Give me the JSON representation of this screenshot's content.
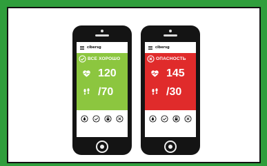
{
  "phones": [
    {
      "brand": "cibersg",
      "status_label": "ВСЕ ХОРОШО",
      "status_icon": "check-circle-icon",
      "status_color": "#8cc63f",
      "heart_rate": "120",
      "steps": "/70",
      "actions": [
        "drop-icon",
        "check-circle-icon",
        "lock-icon",
        "close-circle-icon"
      ]
    },
    {
      "brand": "cibersg",
      "status_label": "ОПАСНОСТЬ",
      "status_icon": "close-circle-icon",
      "status_color": "#e02b2b",
      "heart_rate": "145",
      "steps": "/30",
      "actions": [
        "drop-icon",
        "check-circle-icon",
        "lock-icon",
        "close-circle-icon"
      ]
    }
  ]
}
